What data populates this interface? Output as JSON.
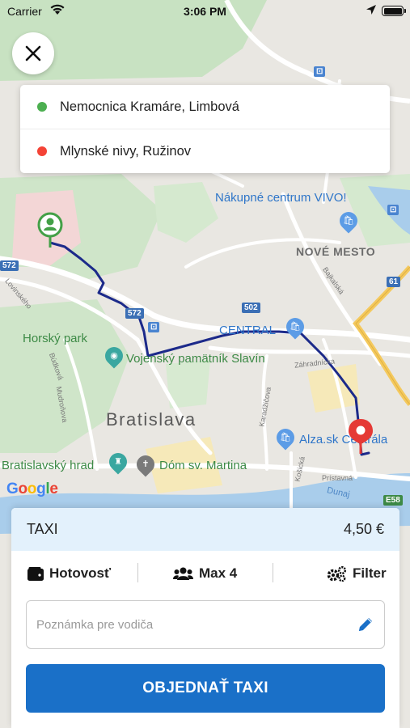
{
  "status_bar": {
    "carrier": "Carrier",
    "time": "3:06 PM"
  },
  "icons": {
    "close": "close-icon",
    "wifi": "wifi-icon",
    "location": "location-arrow-icon",
    "battery": "battery-icon",
    "wallet": "wallet-icon",
    "users": "users-icon",
    "filter": "gears-icon",
    "edit": "pencil-icon",
    "origin_pin": "person-pin-icon",
    "destination_pin": "map-pin-icon"
  },
  "route": {
    "origin": {
      "label": "Nemocnica Kramáre, Limbová",
      "color": "#4caf50"
    },
    "destination": {
      "label": "Mlynské nivy, Ružinov",
      "color": "#f44336"
    }
  },
  "map": {
    "labels": {
      "vivo": "Nákupné centrum VIVO!",
      "nove_mesto": "NOVÉ MESTO",
      "central": "CENTRAL",
      "horsky_park": "Horský park",
      "slavin": "Vojenský pamätník Slavín",
      "bratislava": "Bratislava",
      "alza": "Alza.sk Centrála",
      "hrad": "Bratislavský hrad",
      "dom": "Dóm sv. Martina",
      "dunaj": "Dunaj",
      "google": "Google"
    },
    "streets": {
      "lovinskeho": "Lovinského",
      "budkova": "Búdková",
      "mudronova": "Mudroňova",
      "bajkalska": "Bajkalská",
      "zahradnicka": "Záhradnícka",
      "karadzicova": "Karadžičova",
      "kosicka": "Košická",
      "pristavna": "Prístavná"
    },
    "shields": {
      "s572a": "572",
      "s572b": "572",
      "s502": "502",
      "s61": "61",
      "e58": "E58"
    }
  },
  "sheet": {
    "service_name": "TAXI",
    "price": "4,50 €",
    "payment_label": "Hotovosť",
    "capacity_label": "Max 4",
    "filter_label": "Filter",
    "note_placeholder": "Poznámka pre vodiča",
    "order_label": "OBJEDNAŤ TAXI",
    "accent_color": "#1a70c8"
  }
}
